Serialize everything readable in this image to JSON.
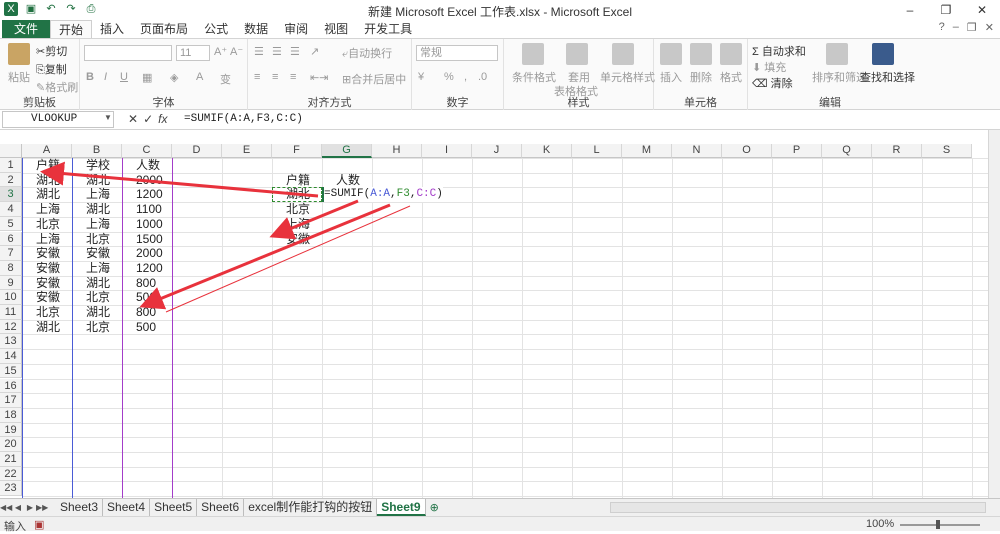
{
  "window": {
    "title": "新建 Microsoft Excel 工作表.xlsx - Microsoft Excel",
    "controls": [
      "–",
      "❐",
      "✕"
    ]
  },
  "qat_icons": [
    "save-icon",
    "undo-icon",
    "redo-icon",
    "print-preview-icon"
  ],
  "tabs": [
    "文件",
    "开始",
    "插入",
    "页面布局",
    "公式",
    "数据",
    "审阅",
    "视图",
    "开发工具"
  ],
  "ribbon": {
    "clipboard": {
      "label": "剪贴板",
      "paste": "粘贴",
      "cut": "剪切",
      "copy": "复制",
      "format_painter": "格式刷"
    },
    "font": {
      "label": "字体",
      "size": "11",
      "bold": "B",
      "italic": "I",
      "underline": "U"
    },
    "alignment": {
      "label": "对齐方式",
      "wrap": "自动换行",
      "merge": "合并后居中"
    },
    "number": {
      "label": "数字",
      "format": "常规",
      "percent": "%",
      "comma": ","
    },
    "styles": {
      "label": "样式",
      "conditional": "条件格式",
      "table_line1": "套用",
      "table_line2": "表格格式",
      "cell_styles": "单元格样式"
    },
    "cells": {
      "label": "单元格",
      "insert": "插入",
      "delete": "删除",
      "format": "格式"
    },
    "editing": {
      "label": "编辑",
      "autosum": "自动求和",
      "fill": "填充",
      "clear": "清除",
      "sort": "排序和筛选",
      "find": "查找和选择"
    }
  },
  "formula_bar": {
    "name_box": "VLOOKUP",
    "formula": "=SUMIF(A:A,F3,C:C)",
    "cancel": "✕",
    "enter": "✓",
    "fx": "fx"
  },
  "columns": [
    "A",
    "B",
    "C",
    "D",
    "E",
    "F",
    "G",
    "H",
    "I",
    "J",
    "K",
    "L",
    "M",
    "N",
    "O",
    "P",
    "Q",
    "R",
    "S"
  ],
  "rows": [
    "1",
    "2",
    "3",
    "4",
    "5",
    "6",
    "7",
    "8",
    "9",
    "10",
    "11",
    "12",
    "13",
    "14",
    "15",
    "16",
    "17",
    "18",
    "19",
    "20",
    "21",
    "22",
    "23"
  ],
  "table": {
    "headers": [
      "户籍",
      "学校",
      "人数"
    ],
    "data": [
      [
        "湖北",
        "湖北",
        "2000"
      ],
      [
        "湖北",
        "上海",
        "1200"
      ],
      [
        "上海",
        "湖北",
        "1100"
      ],
      [
        "北京",
        "上海",
        "1000"
      ],
      [
        "上海",
        "北京",
        "1500"
      ],
      [
        "安徽",
        "安徽",
        "2000"
      ],
      [
        "安徽",
        "上海",
        "1200"
      ],
      [
        "安徽",
        "湖北",
        "800"
      ],
      [
        "安徽",
        "北京",
        "500"
      ],
      [
        "北京",
        "湖北",
        "800"
      ],
      [
        "湖北",
        "北京",
        "500"
      ]
    ]
  },
  "summary": {
    "headers": [
      "户籍",
      "人数"
    ],
    "items": [
      "湖北",
      "北京",
      "上海",
      "安徽"
    ],
    "edit_formula": {
      "prefix": "=SUMIF(",
      "ref1": "A:A",
      "sep1": ",",
      "ref2": "F3",
      "sep2": ",",
      "ref3": "C:C",
      "suffix": ")"
    }
  },
  "sheets": [
    "Sheet3",
    "Sheet4",
    "Sheet5",
    "Sheet6",
    "excel制作能打钩的按钮",
    "Sheet9"
  ],
  "active_sheet": "Sheet9",
  "status": {
    "mode": "输入",
    "zoom": "100%"
  },
  "colors": {
    "accent": "#217346",
    "arrow": "#e8323c",
    "ref_a": "#4a5bd6",
    "ref_f": "#2e8b2e",
    "ref_c": "#a33cc9"
  }
}
